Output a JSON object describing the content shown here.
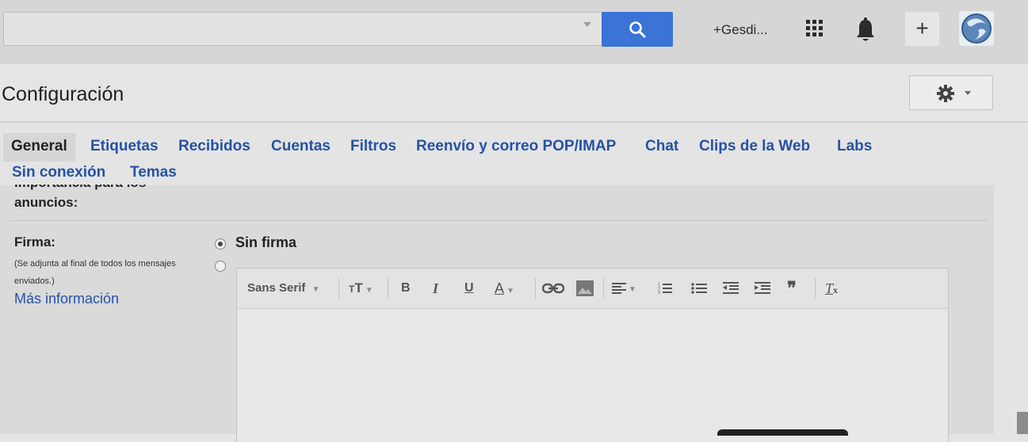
{
  "topbar": {
    "search_placeholder": "",
    "user_link": "+Gesdi...",
    "icons": [
      "search-icon",
      "apps-icon",
      "bell-icon",
      "plus-icon",
      "avatar"
    ]
  },
  "header": {
    "title": "Configuración",
    "settings_icon": "gear-icon"
  },
  "tabs": [
    {
      "label": "General",
      "active": true
    },
    {
      "label": "Etiquetas",
      "active": false
    },
    {
      "label": "Recibidos",
      "active": false
    },
    {
      "label": "Cuentas",
      "active": false
    },
    {
      "label": "Filtros",
      "active": false
    },
    {
      "label": "Reenvío y correo POP/IMAP",
      "active": false
    },
    {
      "label": "Chat",
      "active": false
    },
    {
      "label": "Clips de la Web",
      "active": false
    },
    {
      "label": "Labs",
      "active": false
    },
    {
      "label": "Sin conexión",
      "active": false
    },
    {
      "label": "Temas",
      "active": false
    }
  ],
  "settings": {
    "cut_label": "importancia para los",
    "anuncios_label": "anuncios:",
    "firma": {
      "label": "Firma:",
      "help_text": "(Se adjunta al final de todos los mensajes enviados.)",
      "more_info": "Más información",
      "option_none": "Sin firma",
      "selected": "none"
    },
    "editor": {
      "font_label": "Sans Serif",
      "body": ""
    }
  },
  "colors": {
    "accent_blue": "#3b73d6",
    "link_blue": "#2552a8"
  }
}
